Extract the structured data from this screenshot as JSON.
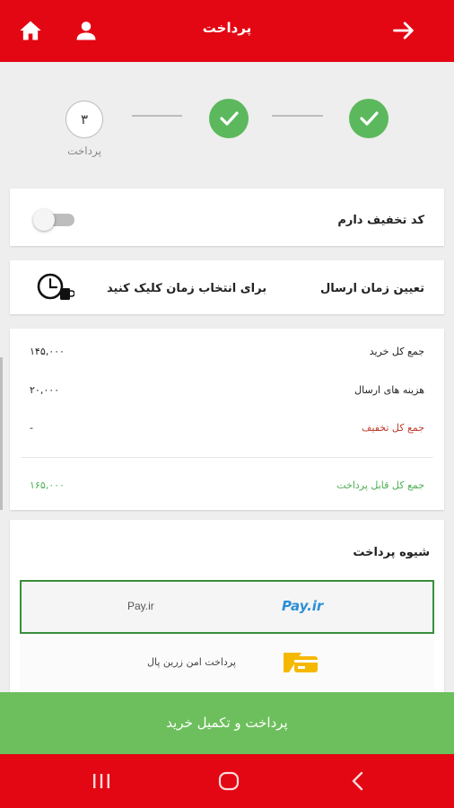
{
  "header": {
    "title": "پرداخت",
    "icons": [
      "home-icon",
      "user-icon",
      "arrow-right-icon"
    ],
    "background": "#e30613"
  },
  "stepper": {
    "steps": [
      {
        "state": "current",
        "number": "۳",
        "label": "پرداخت"
      },
      {
        "state": "done"
      },
      {
        "state": "done"
      }
    ],
    "done_color": "#5cb85c"
  },
  "discount": {
    "label": "کد تخفیف دارم",
    "enabled": false
  },
  "shipping_time": {
    "label": "تعیین زمان ارسال",
    "hint": "برای انتخاب زمان کلیک کنید",
    "icon": "clock-icon"
  },
  "summary": {
    "total_label": "جمع کل خرید",
    "total_value": "۱۴۵,۰۰۰",
    "shipping_label": "هزینه های ارسال",
    "shipping_value": "۲۰,۰۰۰",
    "discount_label": "جمع کل تخفیف",
    "discount_value": "-",
    "payable_label": "جمع کل قابل پرداخت",
    "payable_value": "۱۶۵,۰۰۰"
  },
  "payment": {
    "heading": "شیوه پرداخت",
    "options": [
      {
        "logo_text": "Pay.ir",
        "name": "Pay.ir",
        "selected": true
      },
      {
        "logo_icon": "zarinpal-icon",
        "name": "پرداخت امن زرین پال",
        "selected": false
      }
    ]
  },
  "submit_label": "پرداخت و تکمیل خرید",
  "submit_color": "#6cbf5c",
  "navbar": {
    "icons": [
      "recent-apps-icon",
      "home-circle-icon",
      "back-chevron-icon"
    ]
  }
}
